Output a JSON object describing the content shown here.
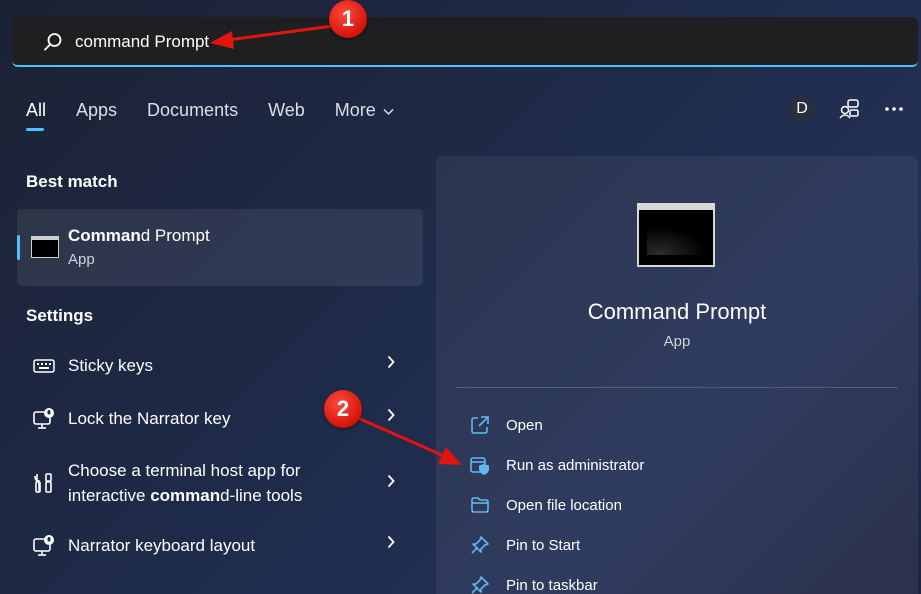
{
  "search": {
    "typed": "command",
    "completion": " Prompt"
  },
  "tabs": [
    {
      "label": "All"
    },
    {
      "label": "Apps"
    },
    {
      "label": "Documents"
    },
    {
      "label": "Web"
    },
    {
      "label": "More"
    }
  ],
  "top_right": {
    "avatar_letter": "D"
  },
  "best_match": {
    "section_title": "Best match",
    "title_bold": "Comman",
    "title_rest": "d Prompt",
    "subtitle": "App",
    "icon": "command-prompt-icon"
  },
  "settings": {
    "section_title": "Settings",
    "items": [
      {
        "label": "Sticky keys",
        "icon": "keyboard-icon"
      },
      {
        "label": "Lock the Narrator key",
        "icon": "narrator-icon"
      },
      {
        "line1": "Choose a terminal host app for",
        "line2_pre": "interactive ",
        "line2_bold": "comman",
        "line2_post": "d-line tools",
        "icon": "developer-tools-icon"
      },
      {
        "label": "Narrator keyboard layout",
        "icon": "narrator-icon"
      }
    ]
  },
  "detail": {
    "title": "Command Prompt",
    "subtitle": "App",
    "actions": [
      {
        "label": "Open",
        "icon": "open-external-icon"
      },
      {
        "label": "Run as administrator",
        "icon": "shield-admin-icon"
      },
      {
        "label": "Open file location",
        "icon": "folder-icon"
      },
      {
        "label": "Pin to Start",
        "icon": "pin-icon"
      },
      {
        "label": "Pin to taskbar",
        "icon": "pin-icon"
      }
    ]
  },
  "callouts": [
    "1",
    "2"
  ],
  "colors": {
    "accent": "#4cc2ff",
    "callout_red": "#d4140b"
  }
}
